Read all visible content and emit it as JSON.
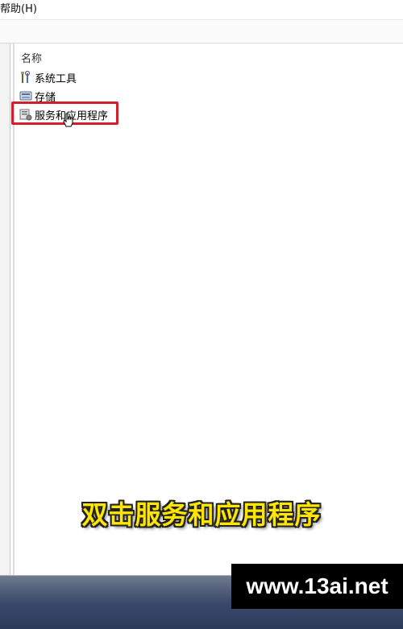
{
  "menubar": {
    "help_label": "帮助(H)"
  },
  "list": {
    "column_name": "名称",
    "items": [
      {
        "label": "系统工具",
        "icon": "tools-icon"
      },
      {
        "label": "存储",
        "icon": "storage-icon"
      },
      {
        "label": "服务和应用程序",
        "icon": "services-icon",
        "highlighted": true
      }
    ]
  },
  "overlay": {
    "caption": "双击服务和应用程序",
    "caption_color": "#ffe600",
    "highlight_color": "#d1202d",
    "watermark": "www.13ai.net"
  }
}
